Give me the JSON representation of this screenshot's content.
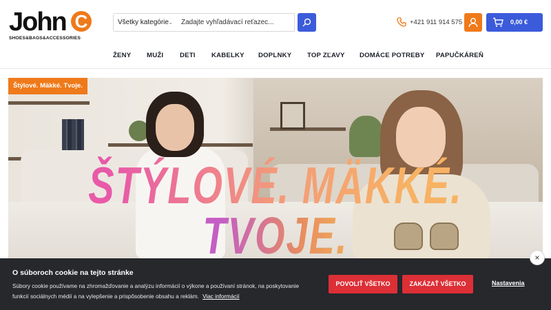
{
  "brand": {
    "logo_text": "John",
    "logo_letter": "C",
    "tagline": "SHOES&BAGS&ACCESSORIES"
  },
  "search": {
    "category": "Všetky kategórie",
    "placeholder": "Zadajte vyhľadávací reťazec..."
  },
  "contact": {
    "phone": "+421 911 914 575"
  },
  "cart": {
    "total": "0,00 €"
  },
  "nav": {
    "items": [
      "ŽENY",
      "MUŽI",
      "DETI",
      "KABELKY",
      "DOPLNKY",
      "TOP ZĽAVY",
      "DOMÁCE POTREBY",
      "PAPUČKÁREŇ"
    ]
  },
  "hero": {
    "badge": "Štýlové. Mäkké. Tvoje.",
    "line1": "ŠTÝLOVÉ. MÄKKÉ.",
    "line2": "TVOJE."
  },
  "cookie": {
    "title": "O súboroch cookie na tejto stránke",
    "text": "Súbory cookie používame na zhromažďovanie a analýzu informácií o výkone a používaní stránok, na poskytovanie funkcií sociálnych médií a na vylepšenie a prispôsobenie obsahu a reklám.",
    "link": "Viac informácií",
    "allow": "POVOLIŤ VŠETKO",
    "deny": "ZAKÁZAŤ VŠETKO",
    "settings": "Nastavenia",
    "close": "×"
  },
  "colors": {
    "accent_orange": "#ef7a1a",
    "accent_blue": "#3b5bdb",
    "cookie_red": "#dc2f36",
    "cookie_bg": "#26282c"
  }
}
